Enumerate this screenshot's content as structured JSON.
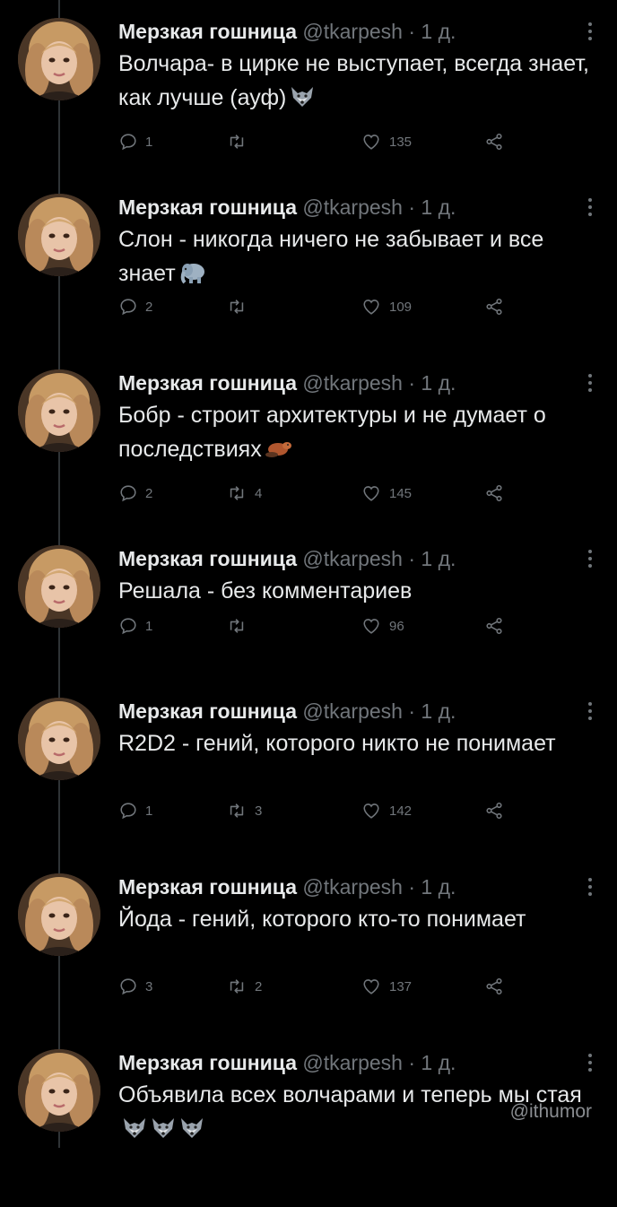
{
  "tweets": [
    {
      "name": "Мерзкая гошница",
      "handle": "@tkarpesh",
      "separator": "·",
      "time": "1 д.",
      "text": "Волчара- в цирке не выступает, всегда знает, как лучше (ауф)",
      "emojis": [
        "wolf-emoji"
      ],
      "replies": "1",
      "retweets": "",
      "likes": "135"
    },
    {
      "name": "Мерзкая гошница",
      "handle": "@tkarpesh",
      "separator": "·",
      "time": "1 д.",
      "text": "Слон - никогда ничего не забывает и все знает",
      "emojis": [
        "elephant-emoji"
      ],
      "replies": "2",
      "retweets": "",
      "likes": "109"
    },
    {
      "name": "Мерзкая гошница",
      "handle": "@tkarpesh",
      "separator": "·",
      "time": "1 д.",
      "text": "Бобр - строит архитектуры и не думает о последствиях",
      "emojis": [
        "beaver-emoji"
      ],
      "replies": "2",
      "retweets": "4",
      "likes": "145"
    },
    {
      "name": "Мерзкая гошница",
      "handle": "@tkarpesh",
      "separator": "·",
      "time": "1 д.",
      "text": "Решала - без комментариев",
      "emojis": [],
      "replies": "1",
      "retweets": "",
      "likes": "96"
    },
    {
      "name": "Мерзкая гошница",
      "handle": "@tkarpesh",
      "separator": "·",
      "time": "1 д.",
      "text": "R2D2 - гений, которого никто не понимает",
      "emojis": [],
      "replies": "1",
      "retweets": "3",
      "likes": "142"
    },
    {
      "name": "Мерзкая гошница",
      "handle": "@tkarpesh",
      "separator": "·",
      "time": "1 д.",
      "text": "Йода - гений, которого кто-то понимает",
      "emojis": [],
      "replies": "3",
      "retweets": "2",
      "likes": "137"
    },
    {
      "name": "Мерзкая гошница",
      "handle": "@tkarpesh",
      "separator": "·",
      "time": "1 д.",
      "text": "Объявила всех волчарами и теперь мы стая",
      "emojis": [
        "wolf-emoji",
        "wolf-emoji",
        "wolf-emoji"
      ],
      "replies": "",
      "retweets": "",
      "likes": ""
    }
  ],
  "watermark": "@ithumor",
  "colors": {
    "background": "#000000",
    "text": "#e7e9ea",
    "muted": "#71767b",
    "thread_line": "#2f3336"
  }
}
